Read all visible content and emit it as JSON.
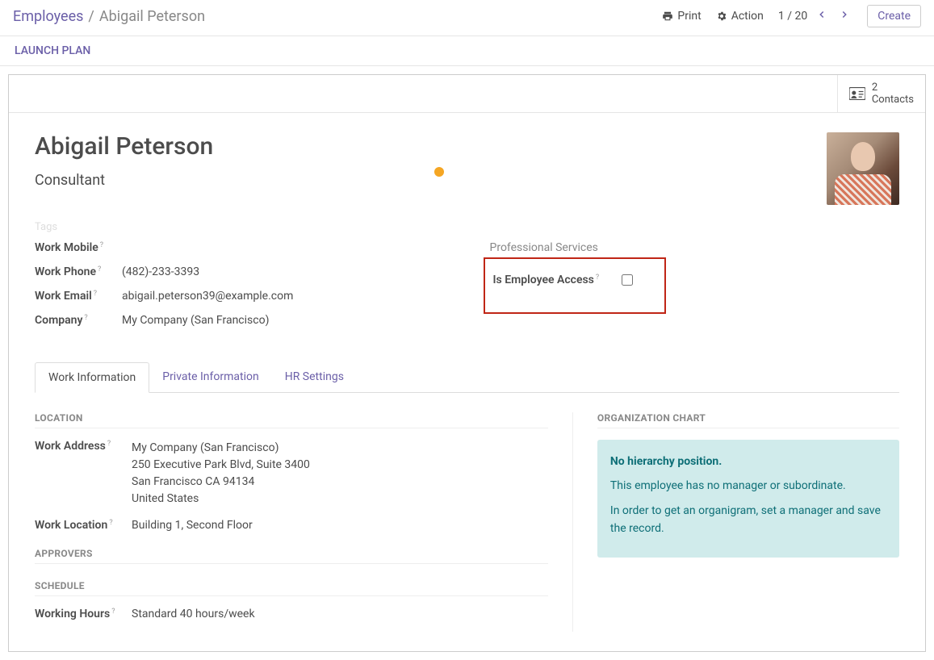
{
  "breadcrumb": {
    "root": "Employees",
    "leaf": "Abigail Peterson"
  },
  "topbar": {
    "print": "Print",
    "action": "Action",
    "pager": "1 / 20",
    "create": "Create"
  },
  "statusbar": {
    "launch": "LAUNCH PLAN"
  },
  "button_box": {
    "contacts_count": "2",
    "contacts_label": "Contacts"
  },
  "employee": {
    "name": "Abigail Peterson",
    "job_title": "Consultant",
    "tags_placeholder": "Tags"
  },
  "fields_left": {
    "work_mobile_label": "Work Mobile",
    "work_mobile_value": "",
    "work_phone_label": "Work Phone",
    "work_phone_value": "(482)-233-3393",
    "work_email_label": "Work Email",
    "work_email_value": "abigail.peterson39@example.com",
    "company_label": "Company",
    "company_value": "My Company (San Francisco)"
  },
  "fields_right": {
    "department": "Professional Services",
    "employee_access_label": "Is Employee Access"
  },
  "tabs": {
    "work_info": "Work Information",
    "private_info": "Private Information",
    "hr_settings": "HR Settings"
  },
  "work_info": {
    "location_title": "LOCATION",
    "work_address_label": "Work Address",
    "work_address_name": "My Company (San Francisco)",
    "work_address_street": "250 Executive Park Blvd, Suite 3400",
    "work_address_city": "San Francisco CA 94134",
    "work_address_country": "United States",
    "work_location_label": "Work Location",
    "work_location_value": "Building 1, Second Floor",
    "approvers_title": "APPROVERS",
    "schedule_title": "SCHEDULE",
    "working_hours_label": "Working Hours",
    "working_hours_value": "Standard 40 hours/week"
  },
  "org_chart": {
    "title": "ORGANIZATION CHART",
    "head": "No hierarchy position.",
    "line1": "This employee has no manager or subordinate.",
    "line2": "In order to get an organigram, set a manager and save the record."
  }
}
